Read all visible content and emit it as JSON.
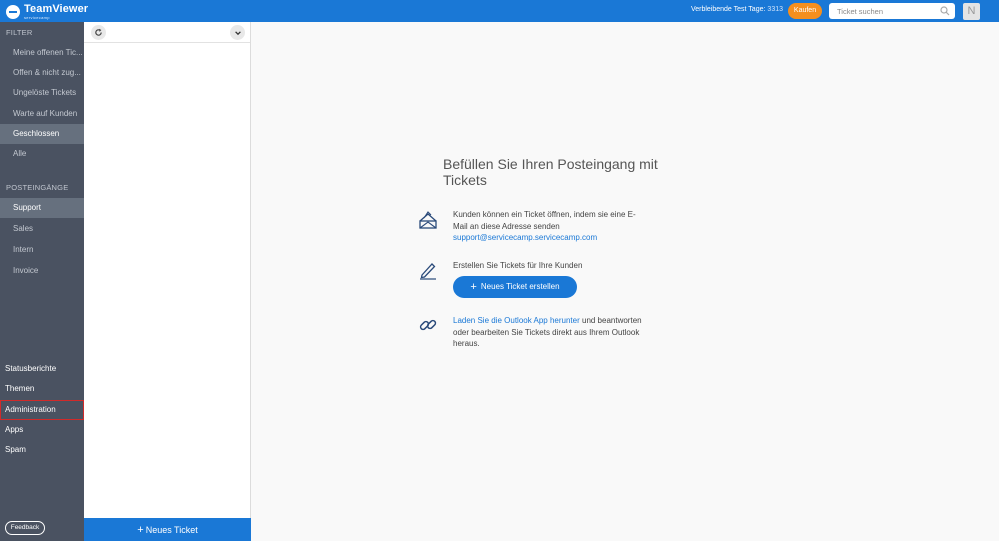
{
  "brand": {
    "name": "TeamViewer",
    "sub": "servicecamp"
  },
  "topbar": {
    "trial_label": "Verbleibende Test Tage:",
    "trial_days": "3313",
    "buy_label": "Kaufen",
    "search_placeholder": "Ticket suchen",
    "avatar_initial": "N"
  },
  "sidebar": {
    "filter_title": "FILTER",
    "filters": [
      {
        "label": "Meine offenen Tic..."
      },
      {
        "label": "Offen & nicht zug..."
      },
      {
        "label": "Ungelöste Tickets"
      },
      {
        "label": "Warte auf Kunden"
      },
      {
        "label": "Geschlossen"
      },
      {
        "label": "Alle"
      }
    ],
    "inbox_title": "POSTEINGÄNGE",
    "inboxes": [
      {
        "label": "Support"
      },
      {
        "label": "Sales"
      },
      {
        "label": "Intern"
      },
      {
        "label": "Invoice"
      }
    ],
    "bottom": [
      {
        "label": "Statusberichte"
      },
      {
        "label": "Themen"
      },
      {
        "label": "Administration"
      },
      {
        "label": "Apps"
      },
      {
        "label": "Spam"
      }
    ],
    "feedback_label": "Feedback"
  },
  "list_panel": {
    "new_ticket_label": "Neues Ticket"
  },
  "empty_state": {
    "heading": "Befüllen Sie Ihren Posteingang mit Tickets",
    "email_text": "Kunden können ein Ticket öffnen, indem sie eine E-Mail an diese Adresse senden",
    "email_address": "support@servicecamp.servicecamp.com",
    "create_text": "Erstellen Sie Tickets für Ihre Kunden",
    "create_button": "Neues Ticket erstellen",
    "outlook_link": "Laden Sie die Outlook App herunter",
    "outlook_text": " und beantworten oder bearbeiten Sie Tickets direkt aus Ihrem Outlook heraus."
  },
  "colors": {
    "topbar": "#1a78d6",
    "sidebar": "#4a5261",
    "active_item": "#66707e",
    "buy_button": "#f58f1e",
    "highlight_border": "#d12a2a"
  }
}
